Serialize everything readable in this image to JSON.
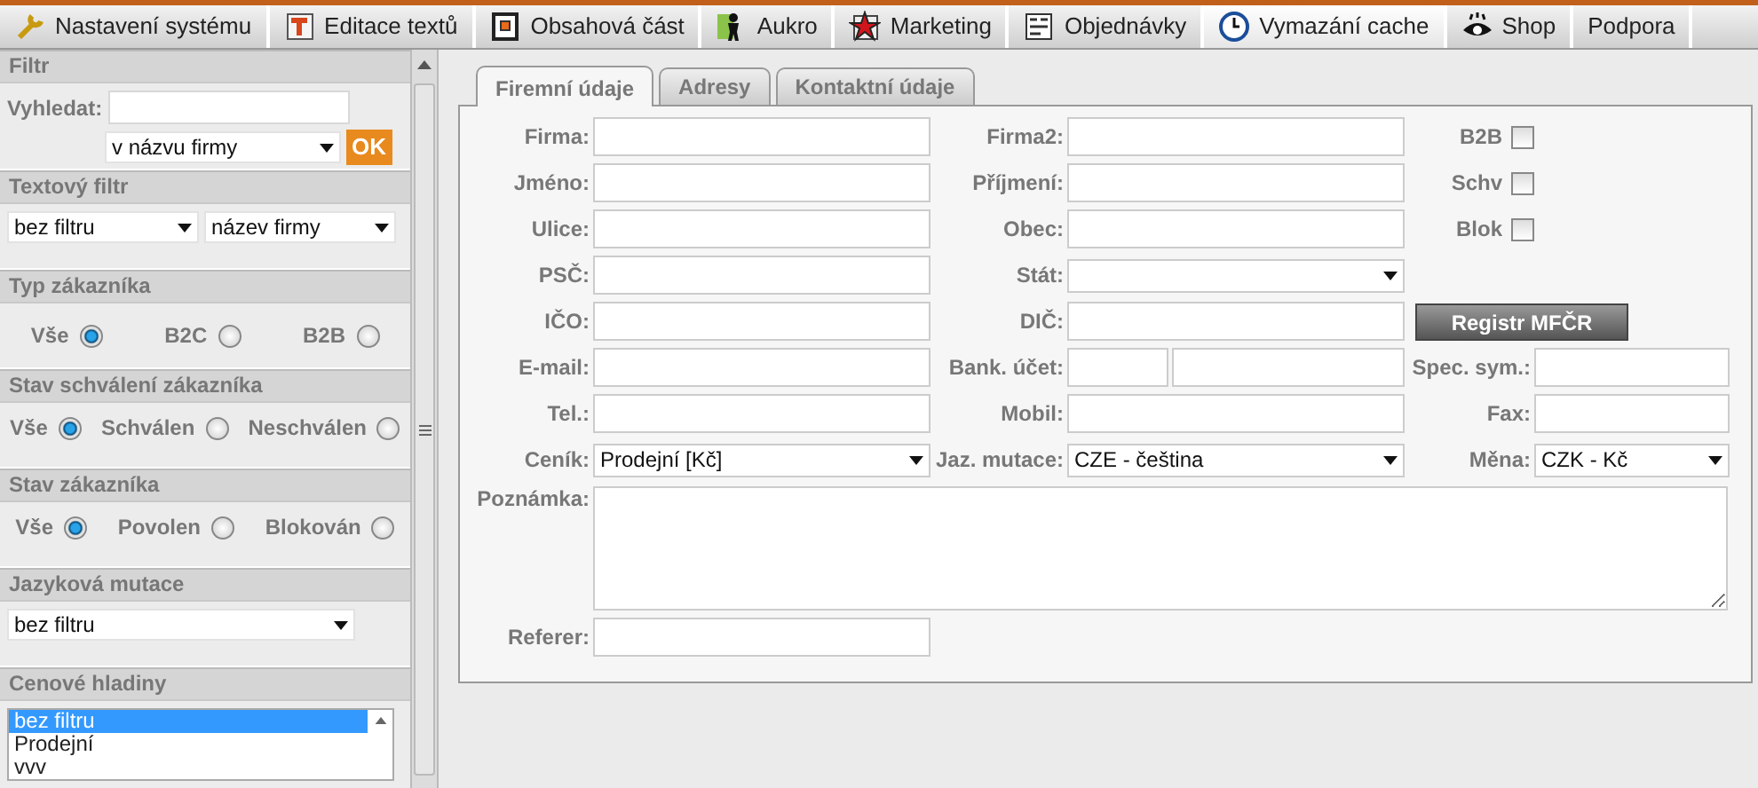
{
  "menu": [
    {
      "label": "Nastavení systému",
      "selected": false
    },
    {
      "label": "Editace textů",
      "selected": false
    },
    {
      "label": "Obsahová část",
      "selected": false
    },
    {
      "label": "Aukro",
      "selected": false
    },
    {
      "label": "Marketing",
      "selected": false
    },
    {
      "label": "Objednávky",
      "selected": false
    },
    {
      "label": "Vymazání cache",
      "selected": true
    },
    {
      "label": "Shop",
      "selected": false
    },
    {
      "label": "Podpora",
      "selected": false
    }
  ],
  "sidebar": [
    {
      "title": "Filtr",
      "kind": "search",
      "label": "Vyhledat:",
      "select": "v názvu firmy",
      "button": "OK"
    },
    {
      "title": "Textový filtr",
      "kind": "selects",
      "selects": [
        "bez filtru",
        "název firmy"
      ]
    },
    {
      "title": "Typ zákazníka",
      "kind": "radios",
      "options": [
        {
          "label": "Vše",
          "selected": true
        },
        {
          "label": "B2C",
          "selected": false
        },
        {
          "label": "B2B",
          "selected": false
        }
      ]
    },
    {
      "title": "Stav schválení zákazníka",
      "kind": "radios",
      "options": [
        {
          "label": "Vše",
          "selected": true
        },
        {
          "label": "Schválen",
          "selected": false
        },
        {
          "label": "Neschválen",
          "selected": false
        }
      ]
    },
    {
      "title": "Stav zákazníka",
      "kind": "radios",
      "options": [
        {
          "label": "Vše",
          "selected": true
        },
        {
          "label": "Povolen",
          "selected": false
        },
        {
          "label": "Blokován",
          "selected": false
        }
      ]
    },
    {
      "title": "Jazyková mutace",
      "kind": "select",
      "select": "bez filtru"
    },
    {
      "title": "Cenové hladiny",
      "kind": "listbox",
      "items": [
        {
          "label": "bez filtru",
          "selected": true
        },
        {
          "label": "Prodejní",
          "selected": false
        },
        {
          "label": "vvv",
          "selected": false
        }
      ]
    }
  ],
  "tabs": [
    {
      "label": "Firemní údaje",
      "selected": true
    },
    {
      "label": "Adresy",
      "selected": false
    },
    {
      "label": "Kontaktní údaje",
      "selected": false
    }
  ],
  "form": [
    [
      {
        "kind": "text",
        "label": "Firma:"
      },
      {
        "kind": "text",
        "label": "Firma2:"
      },
      {
        "kind": "checkbox",
        "label": "B2B",
        "checked": false
      }
    ],
    [
      {
        "kind": "text",
        "label": "Jméno:"
      },
      {
        "kind": "text",
        "label": "Příjmení:"
      },
      {
        "kind": "checkbox",
        "label": "Schv",
        "checked": false
      }
    ],
    [
      {
        "kind": "text",
        "label": "Ulice:"
      },
      {
        "kind": "text",
        "label": "Obec:"
      },
      {
        "kind": "checkbox",
        "label": "Blok",
        "checked": false
      }
    ],
    [
      {
        "kind": "text",
        "label": "PSČ:"
      },
      {
        "kind": "select",
        "label": "Stát:"
      }
    ],
    [
      {
        "kind": "text",
        "label": "IČO:"
      },
      {
        "kind": "text",
        "label": "DIČ:"
      },
      {
        "kind": "button",
        "label": "Registr MFČR"
      }
    ],
    [
      {
        "kind": "text",
        "label": "E-mail:"
      },
      {
        "kind": "split",
        "label": "Bank. účet:"
      },
      {
        "kind": "text",
        "label": "Spec. sym.:"
      }
    ],
    [
      {
        "kind": "text",
        "label": "Tel.:"
      },
      {
        "kind": "text",
        "label": "Mobil:"
      },
      {
        "kind": "text",
        "label": "Fax:"
      }
    ],
    [
      {
        "kind": "select",
        "label": "Ceník:",
        "value": "Prodejní [Kč]"
      },
      {
        "kind": "select",
        "label": "Jaz. mutace:",
        "value": "CZE - čeština"
      },
      {
        "kind": "select",
        "label": "Měna:",
        "value": "CZK - Kč"
      }
    ],
    [
      {
        "kind": "textarea",
        "label": "Poznámka:"
      }
    ],
    [
      {
        "kind": "text",
        "label": "Referer:"
      }
    ]
  ]
}
